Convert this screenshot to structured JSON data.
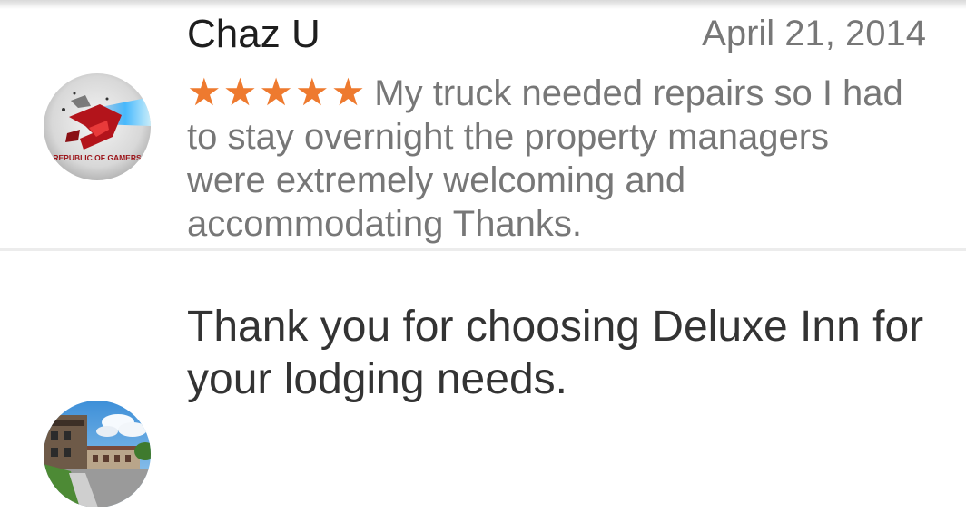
{
  "review": {
    "author": "Chaz U",
    "date": "April 21, 2014",
    "rating": 5,
    "stars": "★★★★★",
    "text": "My truck needed  repairs so I had to stay overnight the property managers were extremely welcoming and accommodating Thanks.",
    "avatar_icon": "republic-of-gamers-logo",
    "avatar_text": "REPUBLIC OF GAMERS"
  },
  "reply": {
    "text": "Thank you for choosing Deluxe Inn for your lodging needs.",
    "avatar_icon": "hotel-building-photo"
  },
  "colors": {
    "star": "#ee7a2f",
    "author": "#1e1e1e",
    "secondary_text": "#777777",
    "reply_text": "#333333",
    "divider": "#ececec"
  }
}
